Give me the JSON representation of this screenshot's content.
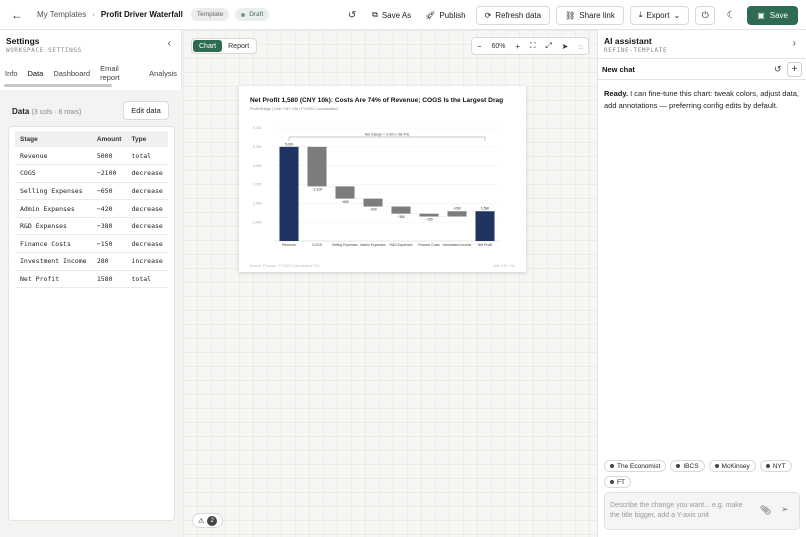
{
  "topbar": {
    "breadcrumb_parent": "My Templates",
    "breadcrumb_current": "Profit Driver Waterfall",
    "template_badge": "Template",
    "draft_badge": "Draft",
    "save_as": "Save As",
    "publish": "Publish",
    "refresh_data": "Refresh data",
    "share_link": "Share link",
    "export": "Export",
    "save": "Save"
  },
  "settings": {
    "title": "Settings",
    "subtitle": "WORKSPACE SETTINGS",
    "tabs": [
      "Info",
      "Data",
      "Dashboard",
      "Email report",
      "Analysis"
    ],
    "active_tab": "Data",
    "data_label": "Data",
    "data_meta": "(3 cols · 8 rows)",
    "edit_data": "Edit data",
    "columns": [
      "Stage",
      "Amount",
      "Type"
    ],
    "rows": [
      [
        "Revenue",
        "5000",
        "total"
      ],
      [
        "COGS",
        "−2100",
        "decrease"
      ],
      [
        "Selling Expenses",
        "−650",
        "decrease"
      ],
      [
        "Admin Expenses",
        "−420",
        "decrease"
      ],
      [
        "R&D Expenses",
        "−380",
        "decrease"
      ],
      [
        "Finance Costs",
        "−150",
        "decrease"
      ],
      [
        "Investment Income",
        "280",
        "increase"
      ],
      [
        "Net Profit",
        "1580",
        "total"
      ]
    ]
  },
  "canvas": {
    "view_chart": "Chart",
    "view_report": "Report",
    "zoom_level": "60%",
    "warnings": "2"
  },
  "chart_data": {
    "type": "bar",
    "subtype": "waterfall",
    "title": "Net Profit 1,580 (CNY 10k): Costs Are 74% of Revenue; COGS Is the Largest Drag",
    "subtitle": "Profit Bridge | Unit: CNY 10k | FY2023 Consolidated",
    "categories": [
      "Revenue",
      "COGS",
      "Selling Expenses",
      "Admin Expenses",
      "R&D Expenses",
      "Finance Costs",
      "Investment Income",
      "Net Profit"
    ],
    "values": [
      5000,
      -2100,
      -650,
      -420,
      -380,
      -150,
      280,
      1580
    ],
    "kinds": [
      "total",
      "decrease",
      "decrease",
      "decrease",
      "decrease",
      "decrease",
      "increase",
      "total"
    ],
    "data_labels": [
      "5,000",
      "−2,100",
      "−650",
      "−420",
      "−380",
      "−150",
      "+280",
      "1,580"
    ],
    "y_ticks": [
      "1,000",
      "2,000",
      "3,000",
      "4,000",
      "5,000",
      "6,000"
    ],
    "ylim": [
      0,
      6000
    ],
    "annotation": "Net change = 3,420 (−68.4%)",
    "source": "Source: Finance · FY2023 Consolidated P&L",
    "unit_note": "Unit: CNY 10k",
    "colors": {
      "total": "#1f3461",
      "decrease": "#7c7c7c",
      "increase": "#7c7c7c"
    }
  },
  "assistant": {
    "title": "AI assistant",
    "subtitle": "REFINE-TEMPLATE",
    "new_chat": "New chat",
    "message_bold": "Ready.",
    "message_text": " I can fine-tune this chart: tweak colors, adjust data, add annotations — preferring config edits by default.",
    "chips": [
      "The Economist",
      "IBCS",
      "McKinsey",
      "NYT",
      "FT"
    ],
    "input_placeholder": "Describe the change you want... e.g. make the title bigger, add a Y-axis unit"
  }
}
